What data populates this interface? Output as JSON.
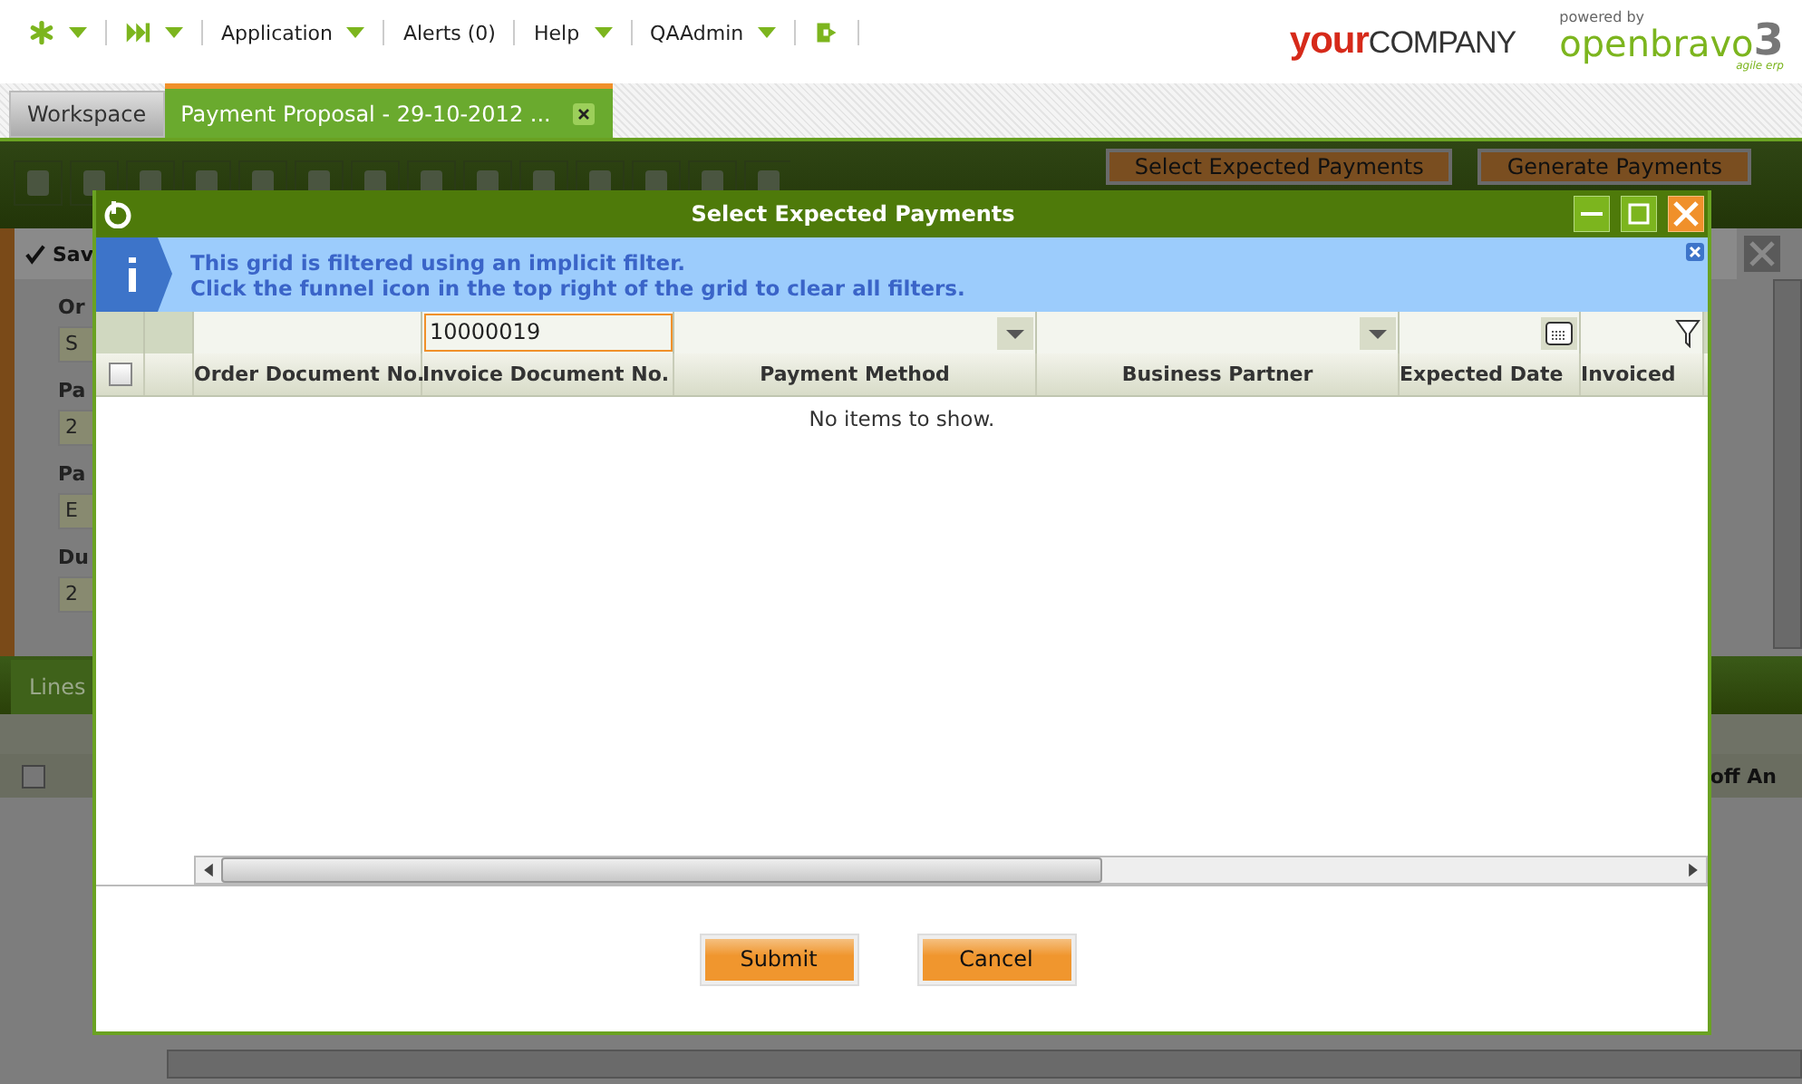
{
  "top_nav": [
    {
      "kind": "asterisk",
      "dropdown": true
    },
    {
      "kind": "skip",
      "dropdown": true
    },
    {
      "kind": "text",
      "label": "Application",
      "dropdown": true
    },
    {
      "kind": "text",
      "label": "Alerts (0)",
      "dropdown": false
    },
    {
      "kind": "text",
      "label": "Help",
      "dropdown": true
    },
    {
      "kind": "text",
      "label": "QAAdmin",
      "dropdown": true
    },
    {
      "kind": "logout",
      "dropdown": false
    }
  ],
  "brand": {
    "company_bold": "your",
    "company": "COMPANY",
    "powered_by": "powered by",
    "product": "openbravo",
    "version": "3",
    "tagline": "agile erp"
  },
  "tabs": [
    {
      "label": "Workspace",
      "selected": false,
      "closable": false
    },
    {
      "label": "Payment Proposal - 29-10-2012 ...",
      "selected": true,
      "closable": true
    }
  ],
  "toolbar": {
    "buttons": [
      "Select Expected Payments",
      "Generate Payments"
    ]
  },
  "form": {
    "status": "Sav",
    "fields": [
      {
        "label": "Or",
        "value": "S"
      },
      {
        "label": "Pa",
        "value": "2"
      },
      {
        "label": "Pa",
        "value": "E"
      },
      {
        "label": "Du",
        "value": "2"
      }
    ]
  },
  "lines": {
    "tab": "Lines",
    "select_all_checked": false,
    "column": "off An"
  },
  "dialog": {
    "title": "Select Expected Payments",
    "info": [
      "This grid is filtered using an implicit filter.",
      "Click the funnel icon in the top right of the grid to clear all filters."
    ],
    "select_all_checked": false,
    "columns": [
      {
        "label": "Order Document No.",
        "kind": "text",
        "selected": false
      },
      {
        "label": "Invoice Document No.",
        "kind": "text",
        "filter_value": "10000019",
        "selected": true
      },
      {
        "label": "Payment Method",
        "kind": "select",
        "selected": false
      },
      {
        "label": "Business Partner",
        "kind": "select",
        "selected": false
      },
      {
        "label": "Expected Date",
        "kind": "date",
        "selected": false
      },
      {
        "label": "Invoiced",
        "kind": "text",
        "selected": false
      }
    ],
    "empty_text": "No items to show.",
    "buttons": [
      "Submit",
      "Cancel"
    ]
  }
}
